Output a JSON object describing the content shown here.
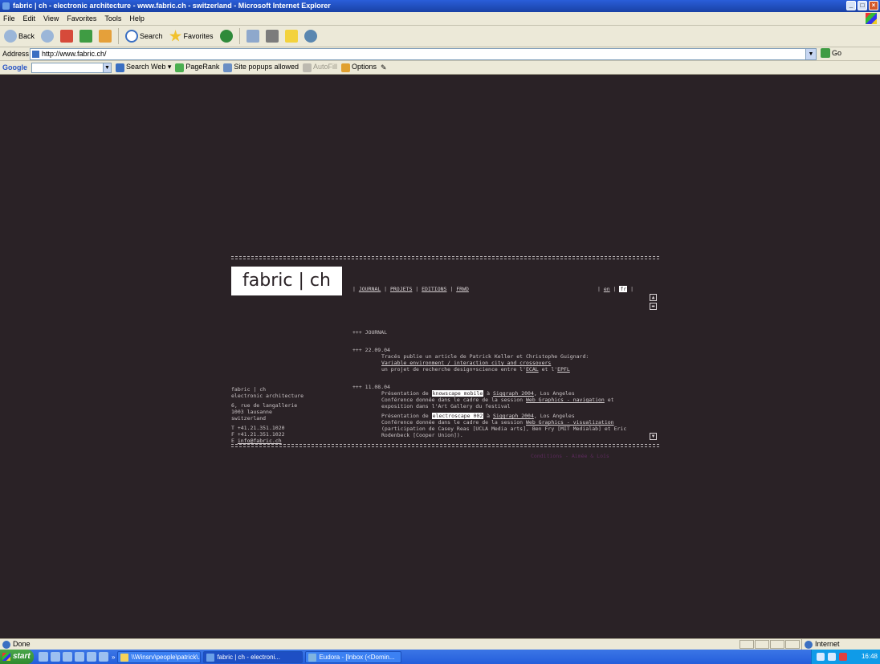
{
  "window": {
    "title": "fabric | ch - electronic architecture - www.fabric.ch - switzerland - Microsoft Internet Explorer"
  },
  "menu": [
    "File",
    "Edit",
    "View",
    "Favorites",
    "Tools",
    "Help"
  ],
  "toolbar": {
    "back": "Back",
    "search": "Search",
    "favorites": "Favorites"
  },
  "address": {
    "label": "Address",
    "url": "http://www.fabric.ch/",
    "go": "Go"
  },
  "googlebar": {
    "logo": "Google",
    "search_web": "Search Web",
    "pagerank": "PageRank",
    "popups": "Site popups allowed",
    "autofill": "AutoFill",
    "options": "Options"
  },
  "site": {
    "logo": "fabric | ch",
    "nav": [
      "JOURNAL",
      "PROJETS",
      "EDITIONS",
      "FRWD"
    ],
    "lang": {
      "en": "en",
      "fr": "fr"
    },
    "journal_heading": "+++ JOURNAL",
    "entry1": {
      "date": "+++ 22.09.04",
      "line1": "Tracés publie un article de Patrick Keller et Christophe Guignard:",
      "link1": "Variable environment / interaction city and crossovers",
      "line3a": "un projet de recherche design+science entre l'",
      "ecal": "ECAL",
      "line3b": " et l'",
      "epfl": "EPFL"
    },
    "entry2": {
      "date": "+++ 11.08.04",
      "p1a": "Présentation de ",
      "p1hl": "knowscape mobile",
      "p1b": " à ",
      "p1link": "Siggraph 2004",
      "p1c": ", Los Angeles",
      "p2a": "Conférence donnée dans le cadre de la session ",
      "p2link": "Web Graphics - navigation",
      "p2b": " et",
      "p3": "exposition dans l'Art Gallery du festival",
      "q1a": "Présentation de ",
      "q1hl": "electroscape 002",
      "q1b": " à ",
      "q1link": "Siggraph 2004",
      "q1c": ", Los Angeles",
      "q2a": "Conférence donnée dans le cadre de la session ",
      "q2link": "Web Graphics - visualization",
      "q3": "(participation de Casey Reas [UCLA Media arts], Ben Fry [MIT Medialab] et Eric",
      "q4": "Rodenbeck [Cooper Union])."
    },
    "address_block": {
      "l1": "fabric | ch",
      "l2": "electronic architecture",
      "l3": "6, rue de langallerie",
      "l4": "1003 lausanne",
      "l5": "switzerland",
      "t": "T +41.21.351.1020",
      "f": "F +41.21.351.1022",
      "e_label": "E ",
      "email": "info@fabric.ch"
    },
    "credits": "Conditions - Aimée & Loïs"
  },
  "status": {
    "text": "Done",
    "zone": "Internet"
  },
  "taskbar": {
    "start": "start",
    "more": "»",
    "buttons": [
      "\\\\Winsrv\\people\\patrick\\...",
      "fabric | ch - electroni...",
      "Eudora - [Inbox (<Domin..."
    ],
    "clock": "16:48"
  }
}
